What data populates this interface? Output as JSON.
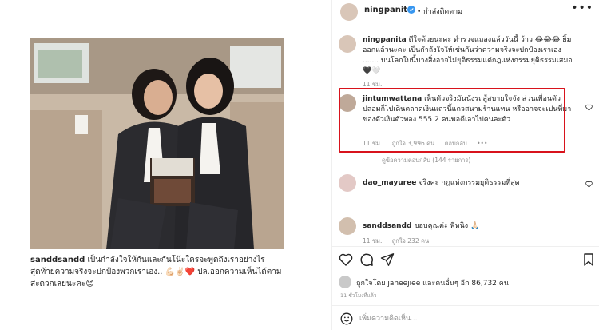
{
  "left_post": {
    "caption_user": "sanddsandd",
    "caption_text": " เป็นกำลังใจให้กันและกันโน๊ะใครจะพูดถึงเราอย่างไร สุดท้ายความจริงจะปกป้องพวกเราเอง.. 💪🏻✌🏻❤️ ปล.ออกความเห็นได้ตามสะดวกเลยนะคะ😊"
  },
  "post": {
    "author": "ningpanita",
    "following_label": "• กำลังติดตาม",
    "more_label": "•••"
  },
  "caption": {
    "user": "ningpanita",
    "text": " ดีใจด้วยนะคะ ตำรวจแถลงแล้ววันนี้ ว้าว 😂😂😂 ยิ้มออกแล้วนะคะ เป็นกำลังใจให้เช่นกันว่าความจริงจะปกป้องเราเอง ....... บนโลกใบนี้บางสิ่งอาจไม่ยุติธรรมแต่กฎแห่งกรรมยุติธรรมเสมอ 🖤🤍",
    "time": "11 ชม."
  },
  "comments": [
    {
      "user": "jintumwattana",
      "text": " เห็นตัวจริงมันนั่งรถสู้สบายใจจัง ส่วนเพื่อนตัวปลอมก็ไปเดินตลาดเงินแถวนี้แถวสนามร้านแทน หรืออาจจะเปนที่มาของตัวเงินตัวทอง 555 2 คนพอดีเอาไปคนละตัว",
      "time": "11 ชม.",
      "likes": "ถูกใจ 3,996 คน",
      "reply": "ตอบกลับ",
      "more": "•••"
    },
    {
      "user": "dao_mayuree",
      "text": " จริงค่ะ กฎแห่งกรรมยุติธรรมที่สุด"
    },
    {
      "user": "sanddsandd",
      "text": " ขอบคุณค่ะ พี่หนิง 🙏🏻",
      "time": "11 ชม.",
      "likes": "ถูกใจ 232 คน"
    }
  ],
  "view_replies": "ดูข้อความตอบกลับ (144 รายการ)",
  "actions": {
    "like_icon": "heart-icon",
    "comment_icon": "comment-icon",
    "share_icon": "share-icon",
    "save_icon": "bookmark-icon"
  },
  "likes_text": "ถูกใจโดย janeejiee และคนอื่นๆ อีก 86,732 คน",
  "post_time": "11 ชั่วโมงที่แล้ว",
  "add_comment": {
    "placeholder": "เพิ่มความคิดเห็น..."
  },
  "colors": {
    "highlight_border": "#d8131c",
    "verified_badge": "#3897f0",
    "meta_text": "#8e8e8e"
  }
}
